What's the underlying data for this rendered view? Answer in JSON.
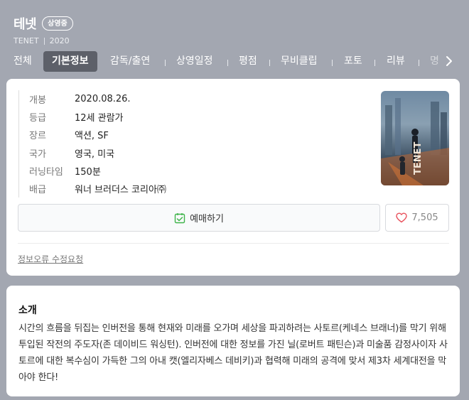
{
  "movie": {
    "title": "테넷",
    "status_badge": "상영중",
    "original_title": "TENET",
    "year": "2020"
  },
  "tabs": [
    {
      "label": "전체",
      "active": false
    },
    {
      "label": "기본정보",
      "active": true
    },
    {
      "label": "감독/출연",
      "active": false
    },
    {
      "label": "상영일정",
      "active": false
    },
    {
      "label": "평점",
      "active": false
    },
    {
      "label": "무비클립",
      "active": false
    },
    {
      "label": "포토",
      "active": false
    },
    {
      "label": "리뷰",
      "active": false
    },
    {
      "label": "명",
      "active": false
    }
  ],
  "info": {
    "rows": [
      {
        "label": "개봉",
        "value": "2020.08.26."
      },
      {
        "label": "등급",
        "value": "12세 관람가"
      },
      {
        "label": "장르",
        "value": "액션, SF"
      },
      {
        "label": "국가",
        "value": "영국, 미국"
      },
      {
        "label": "러닝타임",
        "value": "150분"
      },
      {
        "label": "배급",
        "value": "워너 브러더스 코리아㈜"
      }
    ]
  },
  "actions": {
    "reserve_label": "예매하기",
    "like_count": "7,505"
  },
  "report_link": "정보오류 수정요청",
  "intro": {
    "heading": "소개",
    "text": "시간의 흐름을 뒤집는 인버전을 통해 현재와 미래를 오가며 세상을 파괴하려는 사토르(케네스 브래너)를 막기 위해 투입된 작전의 주도자(존 데이비드 워싱턴). 인버전에 대한 정보를 가진 닐(로버트 패틴슨)과 미술품 감정사이자 사토르에 대한 복수심이 가득한 그의 아내 캣(엘리자베스 데비키)과 협력해 미래의 공격에 맞서 제3차 세계대전을 막아야 한다!"
  },
  "icons": {
    "reserve": "calendar-check-icon",
    "like": "heart-icon",
    "next": "chevron-right-icon"
  },
  "colors": {
    "header_bg": "#a3a7b1",
    "active_tab_bg": "#5d6069",
    "check_green": "#3fb44a",
    "heart_red": "#e8505b"
  }
}
